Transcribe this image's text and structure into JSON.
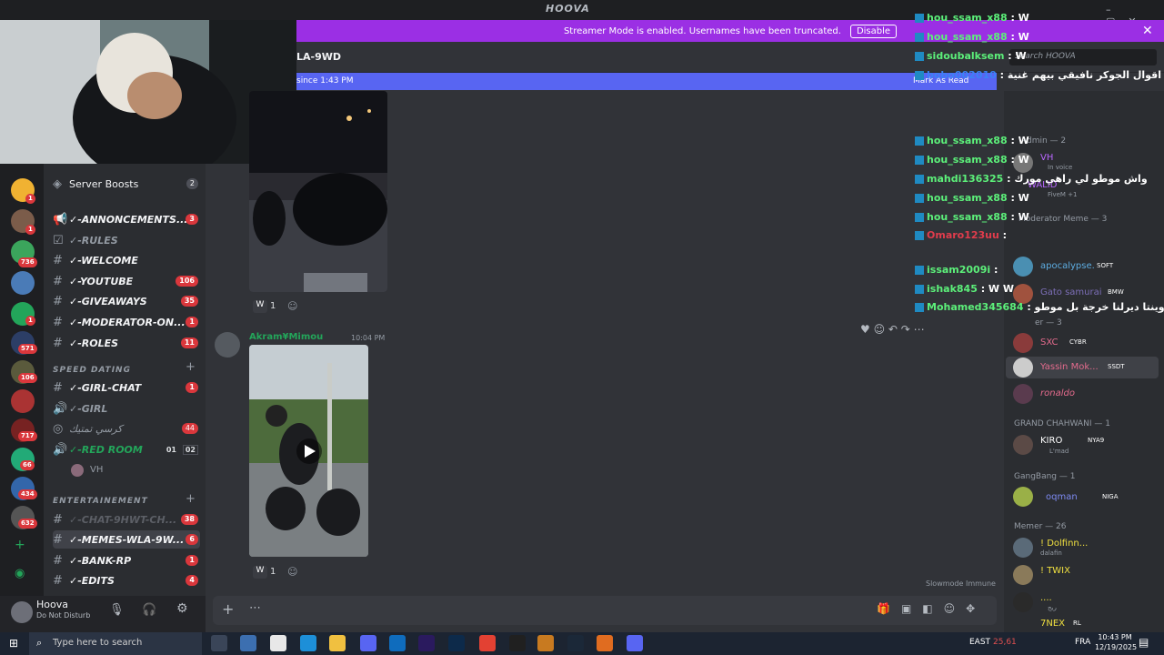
{
  "window": {
    "title": "HOOVA"
  },
  "banner": {
    "text": "Streamer Mode is enabled. Usernames have been truncated.",
    "disable_label": "Disable"
  },
  "channel": {
    "name_fragment": "LA-9WD",
    "new_since": "since 1:43 PM",
    "mark_read": "Mark As Read"
  },
  "search": {
    "placeholder": "Search HOOVA"
  },
  "servers": {
    "badges": [
      "1",
      "1",
      "736",
      "1",
      "571",
      "106",
      "717",
      "66",
      "434",
      "632"
    ]
  },
  "channels": {
    "boosts": {
      "label": "Server Boosts",
      "count": "2"
    },
    "items": [
      {
        "label": "✓-ANNONCEMENTS...",
        "count": "3"
      },
      {
        "label": "✓-RULES",
        "count": ""
      },
      {
        "label": "✓-WELCOME",
        "count": ""
      },
      {
        "label": "✓-YOUTUBE",
        "count": "106"
      },
      {
        "label": "✓-GIVEAWAYS",
        "count": "35"
      },
      {
        "label": "✓-MODERATOR-ON...",
        "count": "1"
      },
      {
        "label": "✓-ROLES",
        "count": "11"
      }
    ],
    "cat_speed": "SPEED DATING",
    "speed_items": [
      {
        "label": "✓-GIRL-CHAT",
        "count": "1"
      },
      {
        "label": "✓-GIRL",
        "count": ""
      },
      {
        "label": "كرسي تمتيك",
        "count": "44"
      },
      {
        "label": "✓-RED ROOM",
        "count": ""
      }
    ],
    "red_room_stats": [
      "01",
      "02"
    ],
    "voice_user": "VH",
    "cat_ent": "ENTERTAINEMENT",
    "ent_items": [
      {
        "label": "✓-CHAT-9HWT-CH...",
        "count": "38"
      },
      {
        "label": "✓-MEMES-WLA-9W...",
        "count": "6"
      },
      {
        "label": "✓-BANK-RP",
        "count": "1"
      },
      {
        "label": "✓-EDITS",
        "count": "4"
      }
    ]
  },
  "user": {
    "name": "Hoova",
    "status": "Do Not Disturb"
  },
  "messages": {
    "reaction_count": "1",
    "author": "Akram¥Mimou",
    "time": "10:04 PM",
    "reaction2_count": "1",
    "slowmode": "Slowmode Immune"
  },
  "chat_overlay": [
    {
      "user": "hou_ssam_x88",
      "msg": "W",
      "color": "#5cf07a"
    },
    {
      "user": "hou_ssam_x88",
      "msg": "W",
      "color": "#5cf07a"
    },
    {
      "user": "sidoubalksem",
      "msg": "W",
      "color": "#5cf07a"
    },
    {
      "user": "bobo002010",
      "msg": "اقوال الجوكر نافيقي بيهم غنية",
      "color": "#3b82f6"
    },
    {
      "user": "hou_ssam_x88",
      "msg": "W",
      "color": "#5cf07a"
    },
    {
      "user": "hou_ssam_x88",
      "msg": "W",
      "color": "#5cf07a"
    },
    {
      "user": "mahdi136325",
      "msg": "واش موطو لي راهي مورك",
      "color": "#5cf07a"
    },
    {
      "user": "hou_ssam_x88",
      "msg": "W",
      "color": "#5cf07a"
    },
    {
      "user": "hou_ssam_x88",
      "msg": "W",
      "color": "#5cf07a"
    },
    {
      "user": "Omaro123uu",
      "msg": "",
      "color": "#e03c4c"
    },
    {
      "user": "issam2009i",
      "msg": "",
      "color": "#5cf07a"
    },
    {
      "user": "ishak845",
      "msg": "W W",
      "color": "#5cf07a"
    },
    {
      "user": "Mohamed345684",
      "msg": "وينتا ديرلنا خرجة بل موطو",
      "color": "#5cf07a"
    }
  ],
  "members": {
    "cat_admin": "Admin — 2",
    "admins": [
      {
        "name": "VH",
        "sub": "In voice"
      },
      {
        "name": "WALID",
        "sub": "FiveM +1"
      }
    ],
    "cat_mod": "Moderator Meme — 3",
    "mods": [
      {
        "name": "apocalypse.",
        "tag": "SOFT"
      },
      {
        "name": "Gato samurai",
        "tag": "BMW"
      }
    ],
    "cat_other": "er — 3",
    "others": [
      {
        "name": "SXC",
        "tag": "CYBR"
      },
      {
        "name": "Yassin Mok...",
        "tag": "SSDT"
      },
      {
        "name": "ronaldo",
        "tag": ""
      }
    ],
    "cat_grand": "GRAND CHAHWANI — 1",
    "grand": [
      {
        "name": "KIRO",
        "tag": "NYA9",
        "sub": "L'mad"
      }
    ],
    "cat_gang": "GangBang — 1",
    "gang": [
      {
        "name": "oqman",
        "tag": "NIGA"
      }
    ],
    "cat_memer": "Memer — 26",
    "memers": [
      {
        "name": "! Dolfinn...",
        "sub": "dalafin"
      },
      {
        "name": "! TWIX",
        "sub": ""
      },
      {
        "name": "....",
        "sub": "ريح"
      },
      {
        "name": "7NEX",
        "tag": "RL"
      }
    ]
  },
  "taskbar": {
    "search": "Type here to search",
    "weather": "EAST",
    "temp": "25,61",
    "lang": "FRA",
    "time": "10:43 PM",
    "date": "12/19/2025"
  }
}
